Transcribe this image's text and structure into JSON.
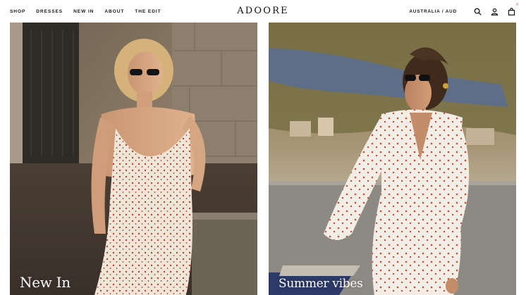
{
  "nav": {
    "items": [
      {
        "label": "SHOP"
      },
      {
        "label": "DRESSES"
      },
      {
        "label": "NEW IN"
      },
      {
        "label": "ABOUT"
      },
      {
        "label": "THE EDIT"
      }
    ]
  },
  "brand": {
    "logo": "ADOORE"
  },
  "tools": {
    "region": "AUSTRALIA / AUD",
    "search_icon": "search-icon",
    "account_icon": "user-icon",
    "cart_icon": "bag-icon",
    "cart_count": "0"
  },
  "tiles": [
    {
      "label": "New In"
    },
    {
      "label": "Summer vibes"
    }
  ],
  "colors": {
    "text": "#111111",
    "cart_badge": "#d9534f",
    "label": "#ffffff"
  }
}
